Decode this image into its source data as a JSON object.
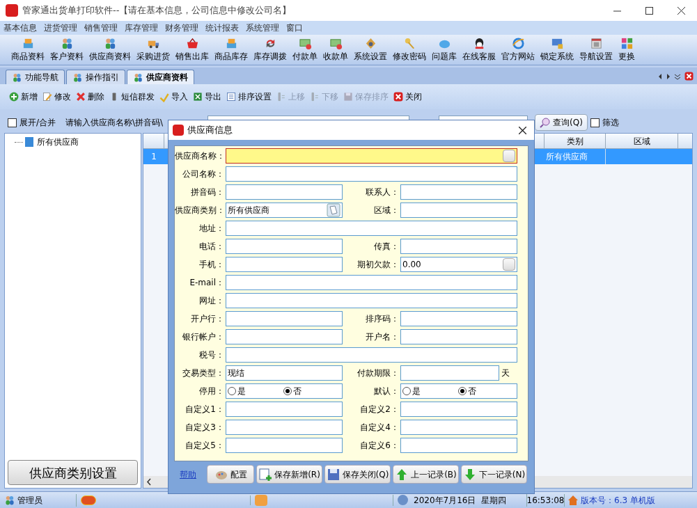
{
  "window": {
    "title": "管家通出货单打印软件--【请在基本信息，公司信息中修改公司名】"
  },
  "menu": [
    "基本信息",
    "进货管理",
    "销售管理",
    "库存管理",
    "财务管理",
    "统计报表",
    "系统管理",
    "窗口"
  ],
  "toolbar": [
    {
      "label": "商品资料"
    },
    {
      "label": "客户资料"
    },
    {
      "label": "供应商资料"
    },
    {
      "label": "采购进货"
    },
    {
      "label": "销售出库"
    },
    {
      "label": "商品库存"
    },
    {
      "label": "库存调拨"
    },
    {
      "label": "付款单"
    },
    {
      "label": "收款单"
    },
    {
      "label": "系统设置"
    },
    {
      "label": "修改密码"
    },
    {
      "label": "问题库"
    },
    {
      "label": "在线客服"
    },
    {
      "label": "官方网站"
    },
    {
      "label": "锁定系统"
    },
    {
      "label": "导航设置"
    },
    {
      "label": "更换"
    }
  ],
  "tabs": [
    {
      "label": "功能导航",
      "selected": false
    },
    {
      "label": "操作指引",
      "selected": false
    },
    {
      "label": "供应商资料",
      "selected": true
    }
  ],
  "actions": [
    {
      "label": "新增",
      "disabled": false
    },
    {
      "label": "修改",
      "disabled": false
    },
    {
      "label": "删除",
      "disabled": false
    },
    {
      "label": "短信群发",
      "disabled": false
    },
    {
      "label": "导入",
      "disabled": false
    },
    {
      "label": "导出",
      "disabled": false
    },
    {
      "label": "排序设置",
      "disabled": false
    },
    {
      "label": "上移",
      "disabled": true
    },
    {
      "label": "下移",
      "disabled": true
    },
    {
      "label": "保存排序",
      "disabled": true
    },
    {
      "label": "关闭",
      "disabled": false
    }
  ],
  "filter": {
    "expand_label": "展开/合并",
    "expand_checked": false,
    "hint": "请输入供应商名称\\拼音码\\",
    "query_button": "查询(Q)",
    "screen_label": "筛选",
    "screen_checked": false
  },
  "tree": [
    {
      "label": "所有供应商"
    }
  ],
  "category_button": "供应商类别设置",
  "table": {
    "columns": [
      "类别",
      "区域"
    ],
    "rows": [
      {
        "index": "1",
        "category": "所有供应商",
        "selected": true
      }
    ]
  },
  "dialog": {
    "title": "供应商信息",
    "rows": [
      [
        {
          "label": "供应商名称：",
          "kind": "button_text",
          "full": true,
          "highlighted": true
        }
      ],
      [
        {
          "label": "公司名称：",
          "kind": "text",
          "full": true
        }
      ],
      [
        {
          "label": "拼音码：",
          "kind": "text"
        },
        {
          "label": "联系人：",
          "kind": "text"
        }
      ],
      [
        {
          "label": "供应商类别：",
          "kind": "lookup",
          "value": "所有供应商"
        },
        {
          "label": "区域：",
          "kind": "text"
        }
      ],
      [
        {
          "label": "地址：",
          "kind": "text",
          "full": true
        }
      ],
      [
        {
          "label": "电话：",
          "kind": "text"
        },
        {
          "label": "传真：",
          "kind": "text"
        }
      ],
      [
        {
          "label": "手机：",
          "kind": "text"
        },
        {
          "label": "期初欠款：",
          "kind": "button_text",
          "value": "0.00"
        }
      ],
      [
        {
          "label": "E-mail：",
          "kind": "text",
          "full": true
        }
      ],
      [
        {
          "label": "网址：",
          "kind": "text",
          "full": true
        }
      ],
      [
        {
          "label": "开户行：",
          "kind": "text"
        },
        {
          "label": "排序码：",
          "kind": "text"
        }
      ],
      [
        {
          "label": "银行帐户：",
          "kind": "text"
        },
        {
          "label": "开户名：",
          "kind": "text"
        }
      ],
      [
        {
          "label": "税号：",
          "kind": "text",
          "full": true
        }
      ],
      [
        {
          "label": "交易类型：",
          "kind": "text",
          "value": "现结"
        },
        {
          "label": "付款期限：",
          "kind": "unit",
          "unit": "天"
        }
      ],
      [
        {
          "label": "停用：",
          "kind": "radio",
          "options": [
            {
              "label": "是",
              "selected": false
            },
            {
              "label": "否",
              "selected": true
            }
          ]
        },
        {
          "label": "默认：",
          "kind": "radio",
          "options": [
            {
              "label": "是",
              "selected": false
            },
            {
              "label": "否",
              "selected": true
            }
          ]
        }
      ],
      [
        {
          "label": "自定义1：",
          "kind": "text"
        },
        {
          "label": "自定义2：",
          "kind": "text"
        }
      ],
      [
        {
          "label": "自定义3：",
          "kind": "text"
        },
        {
          "label": "自定义4：",
          "kind": "text"
        }
      ],
      [
        {
          "label": "自定义5：",
          "kind": "text"
        },
        {
          "label": "自定义6：",
          "kind": "text"
        }
      ]
    ],
    "help_link": "帮助",
    "buttons": [
      "配置",
      "保存新增(R)",
      "保存关闭(Q)",
      "上一记录(B)",
      "下一记录(N)"
    ]
  },
  "status_bar": {
    "user": "管理员",
    "date": "2020年7月16日",
    "weekday": "星期四",
    "time": "16:53:08",
    "version": "版本号：6.3 单机版"
  }
}
